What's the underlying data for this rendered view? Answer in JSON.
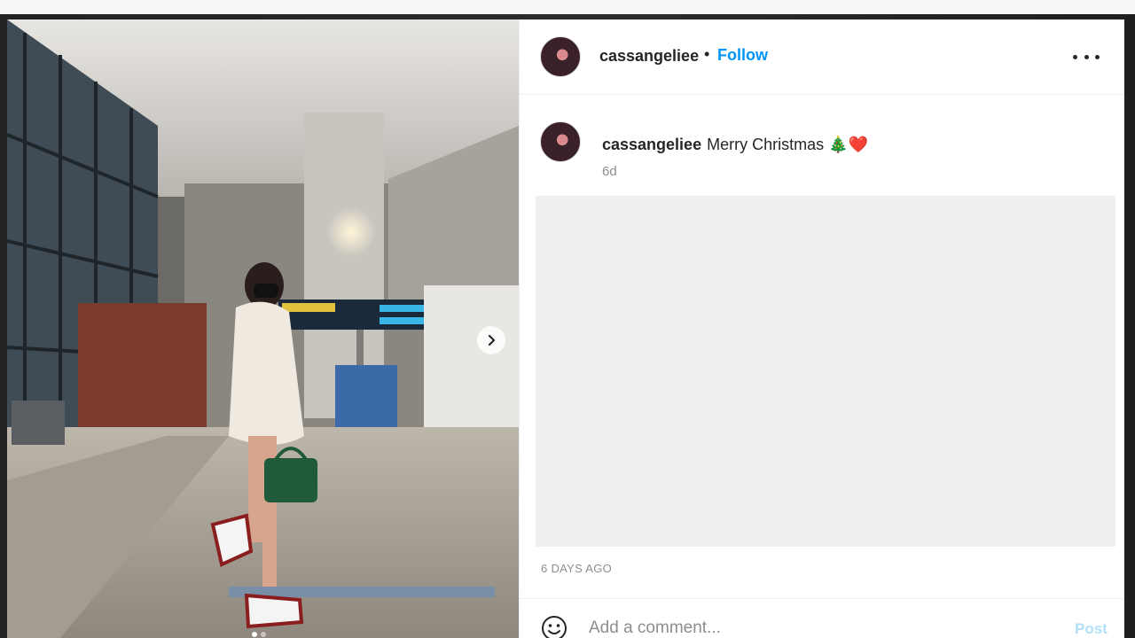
{
  "post": {
    "author": "cassangeliee",
    "separator": "•",
    "follow_label": "Follow",
    "caption": "Merry Christmas 🎄❤️",
    "time_ago": "6d",
    "date": "6 DAYS AGO"
  },
  "comment": {
    "placeholder": "Add a comment...",
    "post_label": "Post"
  },
  "icons": {
    "more": "more-options-icon",
    "next": "chevron-right-icon",
    "emoji": "smiley-icon"
  },
  "colors": {
    "follow_blue": "#0095f6",
    "post_disabled": "#b2dffc",
    "muted": "#8e8e8e"
  }
}
